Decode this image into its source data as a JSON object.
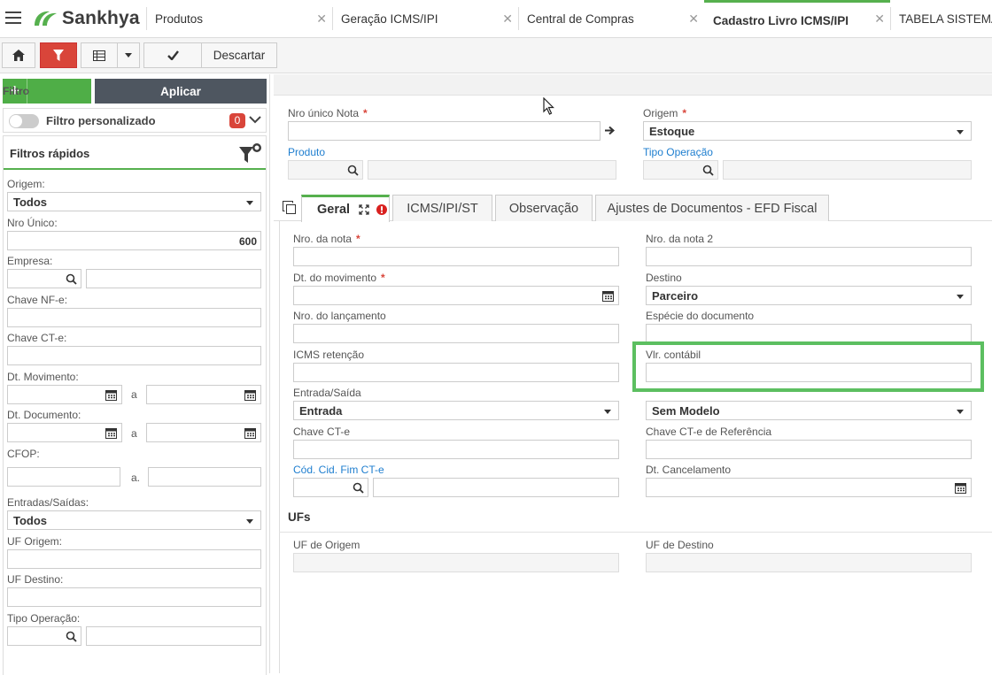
{
  "brand": {
    "name": "Sankhya"
  },
  "tabs": [
    {
      "label": "Produtos"
    },
    {
      "label": "Geração ICMS/IPI"
    },
    {
      "label": "Central de Compras"
    },
    {
      "label": "Cadastro Livro ICMS/IPI",
      "active": true
    },
    {
      "label": "TABELA SISTEMA"
    }
  ],
  "toolbar": {
    "discard_label": "Descartar"
  },
  "filter_panel": {
    "filtro_label": "Filtro",
    "aplicar_label": "Aplicar",
    "personalizado_label": "Filtro personalizado",
    "personalizado_count": "0",
    "quick_title": "Filtros rápidos",
    "origem_label": "Origem:",
    "origem_value": "Todos",
    "nro_unico_label": "Nro Único:",
    "nro_unico_value": "600",
    "empresa_label": "Empresa:",
    "chave_nfe_label": "Chave NF-e:",
    "chave_cte_label": "Chave CT-e:",
    "dt_mov_label": "Dt. Movimento:",
    "range_sep": "a",
    "dt_doc_label": "Dt. Documento:",
    "cfop_label": "CFOP:",
    "cfop_sep": "a.",
    "entradas_label": "Entradas/Saídas:",
    "entradas_value": "Todos",
    "uf_origem_label": "UF Origem:",
    "uf_destino_label": "UF Destino:",
    "tipo_op_label": "Tipo Operação:"
  },
  "header_form": {
    "nro_unico_label": "Nro único Nota",
    "origem_label": "Origem",
    "origem_value": "Estoque",
    "produto_label": "Produto",
    "tipo_op_label": "Tipo Operação"
  },
  "form_tabs": [
    {
      "label": "Geral",
      "active": true
    },
    {
      "label": "ICMS/IPI/ST"
    },
    {
      "label": "Observação"
    },
    {
      "label": "Ajustes de Documentos - EFD Fiscal"
    }
  ],
  "geral": {
    "nro_nota_label": "Nro. da nota",
    "nro_nota2_label": "Nro. da nota 2",
    "dt_mov_label": "Dt. do movimento",
    "destino_label": "Destino",
    "destino_value": "Parceiro",
    "nro_lanc_label": "Nro. do lançamento",
    "especie_label": "Espécie do documento",
    "icms_ret_label": "ICMS retenção",
    "vlr_contabil_label": "Vlr. contábil",
    "entrada_saida_label": "Entrada/Saída",
    "entrada_saida_value": "Entrada",
    "modelo_value": "Sem Modelo",
    "chave_cte_label": "Chave CT-e",
    "chave_cte_ref_label": "Chave CT-e de Referência",
    "cod_cid_label": "Cód. Cid. Fim CT-e",
    "dt_cancel_label": "Dt. Cancelamento",
    "ufs_title": "UFs",
    "uf_origem_label": "UF de Origem",
    "uf_destino_label": "UF de Destino"
  },
  "colors": {
    "brand_green": "#56b04e",
    "danger": "#d9453a",
    "link": "#1e7ecf",
    "highlight": "#5cbf60"
  }
}
